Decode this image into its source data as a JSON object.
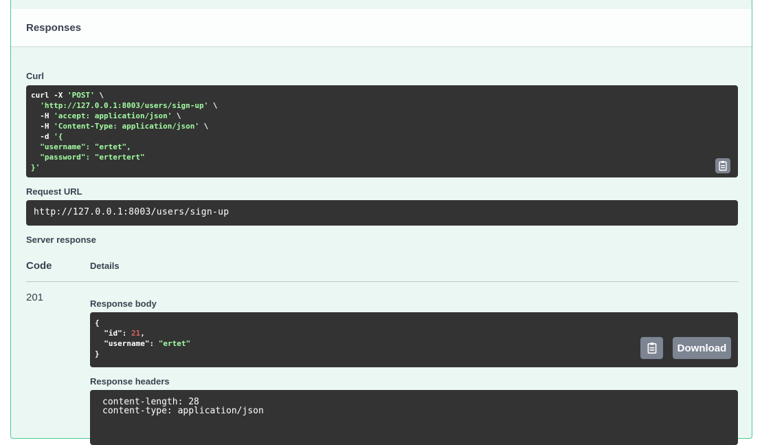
{
  "responses": {
    "title": "Responses"
  },
  "curl": {
    "label": "Curl",
    "lines": [
      {
        "pre": "curl -X ",
        "str": "'POST'",
        "post": " \\"
      },
      {
        "pre": "  ",
        "str": "'http://127.0.0.1:8003/users/sign-up'",
        "post": " \\"
      },
      {
        "pre": "  -H ",
        "str": "'accept: application/json'",
        "post": " \\"
      },
      {
        "pre": "  -H ",
        "str": "'Content-Type: application/json'",
        "post": " \\"
      },
      {
        "pre": "  -d ",
        "str": "'{",
        "post": ""
      },
      {
        "pre": "",
        "str": "  \"username\": \"ertet\",",
        "post": ""
      },
      {
        "pre": "",
        "str": "  \"password\": \"ertertert\"",
        "post": ""
      },
      {
        "pre": "",
        "str": "}'",
        "post": ""
      }
    ]
  },
  "request_url": {
    "label": "Request URL",
    "value": "http://127.0.0.1:8003/users/sign-up"
  },
  "server_response": {
    "label": "Server response",
    "col_code": "Code",
    "col_details": "Details",
    "code": "201",
    "body_label": "Response body",
    "body": {
      "open": "{",
      "id_key": "\"id\"",
      "id_value": "21",
      "username_key": "\"username\"",
      "username_value": "\"ertet\"",
      "close": "}"
    },
    "download_label": "Download",
    "headers_label": "Response headers",
    "headers_lines": [
      "content-length: 28",
      "content-type: application/json"
    ]
  },
  "icons": {
    "copy": "clipboard-copy-icon"
  },
  "colors": {
    "accent": "#49cc90",
    "code_bg": "#333333",
    "string": "#a2fca2",
    "number": "#d36363"
  }
}
